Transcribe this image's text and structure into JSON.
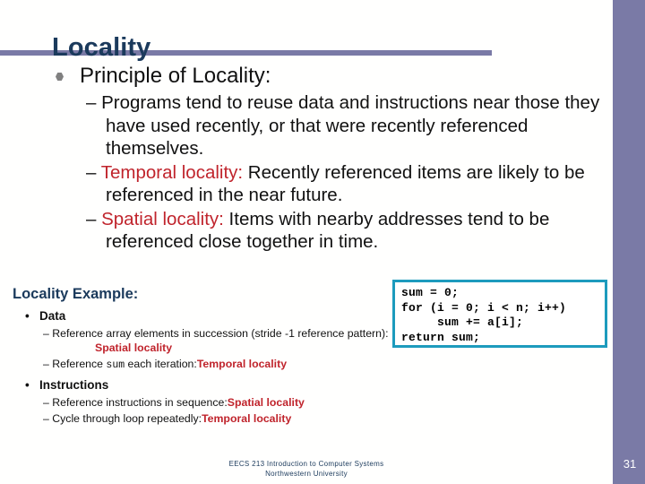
{
  "slide": {
    "title": "Locality",
    "page_number": "31",
    "accent_color": "#7a7aa6",
    "title_color": "#1b3a5c",
    "highlight_color": "#c0242c",
    "code_border_color": "#1d9bbd"
  },
  "main": {
    "bullet_label": "Principle of Locality:",
    "points": [
      {
        "dash": "–",
        "text": "Programs tend to reuse data and instructions near those they have used recently, or that were recently referenced themselves."
      },
      {
        "dash": "–",
        "term": "Temporal locality",
        "sep": ":",
        "text": "  Recently referenced items are likely to be referenced in the near future."
      },
      {
        "dash": "–",
        "term": "Spatial locality",
        "sep": ":",
        "text": "  Items with nearby addresses tend to be referenced close together in time."
      }
    ]
  },
  "example": {
    "heading": "Locality Example:",
    "groups": [
      {
        "bullet": "•",
        "label": "Data",
        "items": [
          {
            "dash": "–",
            "text_before": "Reference array elements in succession (stride -1 reference pattern):",
            "highlight": "Spatial locality"
          },
          {
            "dash": "–",
            "text_before": "Reference ",
            "code": "sum",
            "text_after": " each iteration:",
            "highlight": "Temporal locality"
          }
        ]
      },
      {
        "bullet": "•",
        "label": "Instructions",
        "items": [
          {
            "dash": "–",
            "text_before": "Reference instructions in sequence:",
            "highlight": "Spatial locality"
          },
          {
            "dash": "–",
            "text_before": "Cycle through loop repeatedly:",
            "highlight": "Temporal locality"
          }
        ]
      }
    ]
  },
  "code": {
    "listing": "sum = 0;\nfor (i = 0; i < n; i++)\n     sum += a[i];\nreturn sum;"
  },
  "footer": {
    "line1": "EECS 213 Introduction to Computer Systems",
    "line2": "Northwestern University"
  }
}
